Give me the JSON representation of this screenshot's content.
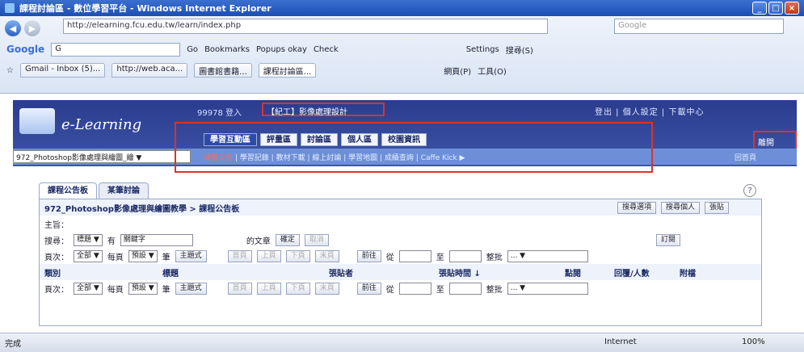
{
  "window": {
    "title": "課程討論區 - 數位學習平台 - Windows Internet Explorer",
    "controls": [
      "_",
      "□",
      "×"
    ]
  },
  "browser": {
    "address": "http://elearning.fcu.edu.tw/learn/index.php",
    "search_placeholder": "Google",
    "toolbar1": [
      "Go",
      "Bookmarks",
      "Popups okay",
      "Check",
      "Settings",
      "搜尋(S)"
    ],
    "google_label": "Google",
    "google_box": "G",
    "tabs": [
      "Gmail - Inbox (5)...",
      "http://web.aca...",
      "圖書館書籍...",
      "課程討論區..."
    ],
    "tools": [
      "網頁(P)",
      "工具(O)"
    ]
  },
  "site": {
    "logo_text": "e-Learning",
    "user_info": "99978 登入",
    "course_top": "【紀工】影像處理設計",
    "top_links": "登出 | 個人設定 | 下載中心",
    "main_tabs": [
      "學習互動區",
      "評量區",
      "討論區",
      "個人區",
      "校園資訊"
    ],
    "course_select": "972_Photoshop影像處理與繪圖_繪 ",
    "sub_items": [
      "課程公告",
      "學習記錄",
      "教材下載",
      "線上討論",
      "學習地圖",
      "成績查詢",
      "Caffe Kick"
    ],
    "sub_right": "回首頁",
    "right_box": "離開"
  },
  "content": {
    "tabs": [
      "課程公告板",
      "某筆討論"
    ],
    "help": "?",
    "breadcrumb": "972_Photoshop影像處理與繪圖教學 > 課程公告板",
    "actions": [
      "搜尋選項",
      "搜尋個人",
      "張貼"
    ],
    "subject_label": "主旨：",
    "search": {
      "label": "搜尋：",
      "field": "標題",
      "has": "有",
      "keyword_btn": "關鍵字",
      "article": "的文章",
      "go": "確定",
      "reset": "取消",
      "view": "訂閱"
    },
    "pager": {
      "label": "頁次：",
      "mode": "全部",
      "per_page": "每頁",
      "per_value": "預設",
      "sort": "筆",
      "style": "主題式",
      "nav": [
        "首頁",
        "上頁",
        "下頁",
        "末頁"
      ],
      "jump": "前往",
      "from": "從",
      "to": "至",
      "batch": "整批",
      "batch_value": "..."
    },
    "columns": [
      "類別",
      "標題",
      "張貼者",
      "張貼時間 ↓",
      "點閱",
      "回覆/人數",
      "附檔"
    ]
  },
  "status": {
    "left": "完成",
    "zone": "Internet",
    "zoom": "100%"
  }
}
